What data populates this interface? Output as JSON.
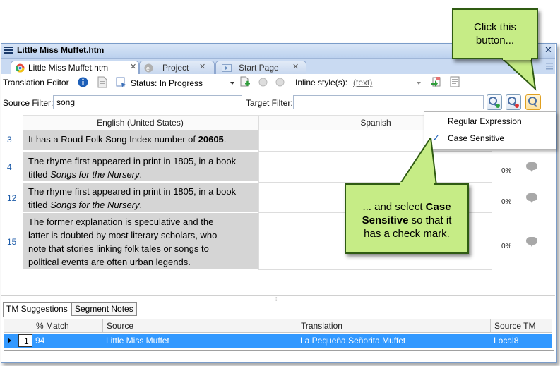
{
  "window": {
    "title": "Little Miss Muffet.htm"
  },
  "tabs": [
    {
      "label": "Little Miss Muffet.htm",
      "close": "✕"
    },
    {
      "label": "Project",
      "close": "✕"
    },
    {
      "label": "Start Page",
      "close": "✕"
    }
  ],
  "toolbar": {
    "label": "Translation Editor",
    "status": "Status: In Progress",
    "inline_label": "Inline style(s):",
    "inline_value": "(text)"
  },
  "filters": {
    "source_label": "Source Filter:",
    "source_value": "song",
    "target_label": "Target Filter:",
    "target_value": ""
  },
  "columns": {
    "source": "English (United States)",
    "target": "Spanish"
  },
  "rows": [
    {
      "num": "3",
      "text_pre": "It has a Roud Folk Song Index number of ",
      "text_bold": "20605",
      "text_post": ".",
      "pct": ""
    },
    {
      "num": "4",
      "line1": "The rhyme first appeared in print in 1805, in a book",
      "line2_pre": "titled ",
      "line2_italic": "Songs for the Nursery",
      "line2_post": ".",
      "pct": "0%"
    },
    {
      "num": "12",
      "line1": "The rhyme first appeared in print in 1805, in a book",
      "line2_pre": "titled ",
      "line2_italic": "Songs for the Nursery",
      "line2_post": ".",
      "pct": "0%"
    },
    {
      "num": "15",
      "lines": [
        "The former explanation is speculative and the",
        "latter is doubted by most literary scholars, who",
        "note that stories linking folk tales or songs to",
        "political events are often urban legends."
      ],
      "pct": "0%"
    }
  ],
  "menu": {
    "items": [
      {
        "label": "Regular Expression",
        "checked": false
      },
      {
        "label": "Case Sensitive",
        "checked": true
      }
    ],
    "check": "✓"
  },
  "bottom_tabs": [
    "TM Suggestions",
    "Segment Notes"
  ],
  "grid": {
    "headers": [
      "% Match",
      "Source",
      "Translation",
      "Source TM"
    ],
    "row": {
      "index": "1",
      "match": "94",
      "source": "Little Miss Muffet",
      "translation": "La Pequeña Señorita Muffet",
      "tm": "Local8"
    }
  },
  "callouts": {
    "top_line1": "Click this",
    "top_line2": "button...",
    "bottom_pre": "... and select ",
    "bottom_bold1": "Case",
    "bottom_bold2": "Sensitive",
    "bottom_post1": " so that it",
    "bottom_post2": "has a check mark."
  },
  "colors": {
    "accent": "#3399ff",
    "callout": "#c6ec86",
    "row_bg": "#d5d5d5",
    "titlebar": "#bcd1ee"
  }
}
